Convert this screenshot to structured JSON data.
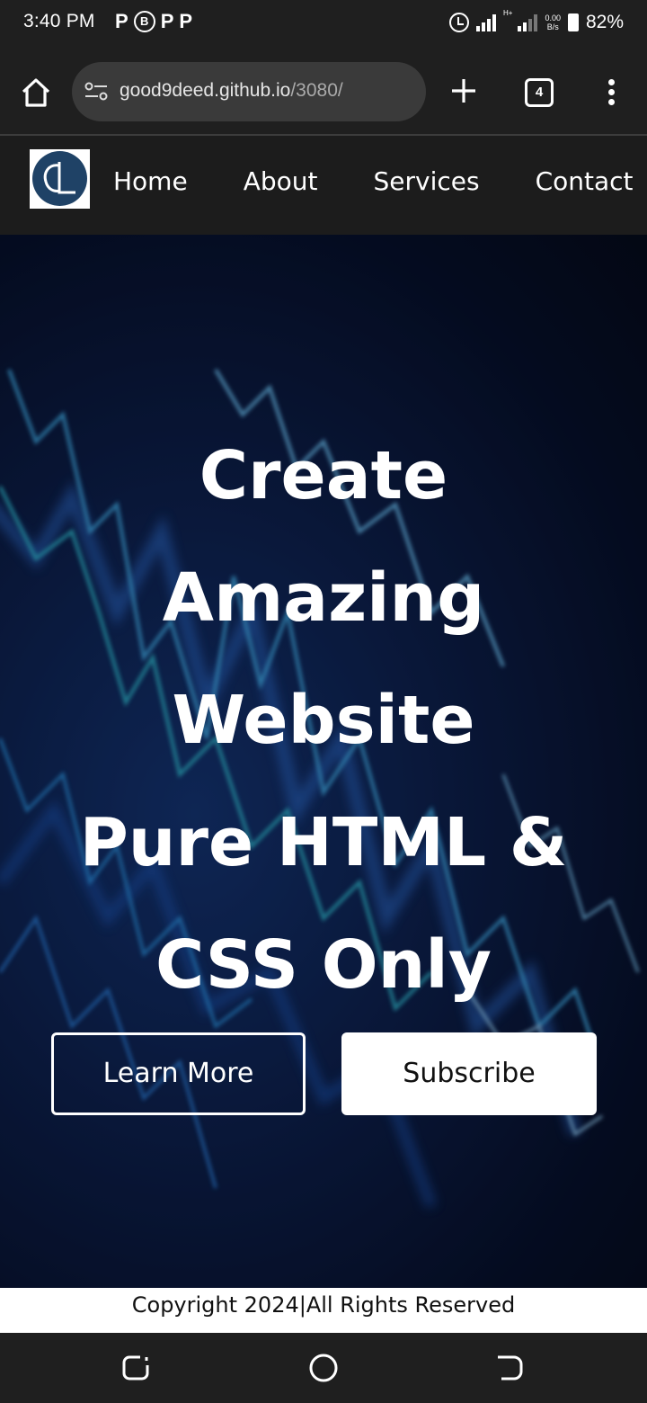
{
  "status_bar": {
    "time": "3:40 PM",
    "notifications": [
      "P",
      "B",
      "P",
      "P"
    ],
    "network_tag": "H+",
    "speed_value": "0.00",
    "speed_unit": "B/s",
    "battery": "82%"
  },
  "browser": {
    "url_host": "good9deed.github.io",
    "url_path": "/3080/",
    "tab_count": "4"
  },
  "site": {
    "logo_text": "CL",
    "nav": [
      "Home",
      "About",
      "Services",
      "Contact"
    ],
    "hero": {
      "title_lines": [
        "Create",
        "Amazing",
        "Website",
        "Pure HTML &",
        "CSS Only"
      ],
      "learn_more": "Learn More",
      "subscribe": "Subscribe"
    },
    "footer": "Copyright 2024|All Rights Reserved"
  },
  "colors": {
    "hero_bg": "#0b1c44",
    "logo_circle": "#1f4266",
    "chart_lines": "#3fa9e0"
  }
}
